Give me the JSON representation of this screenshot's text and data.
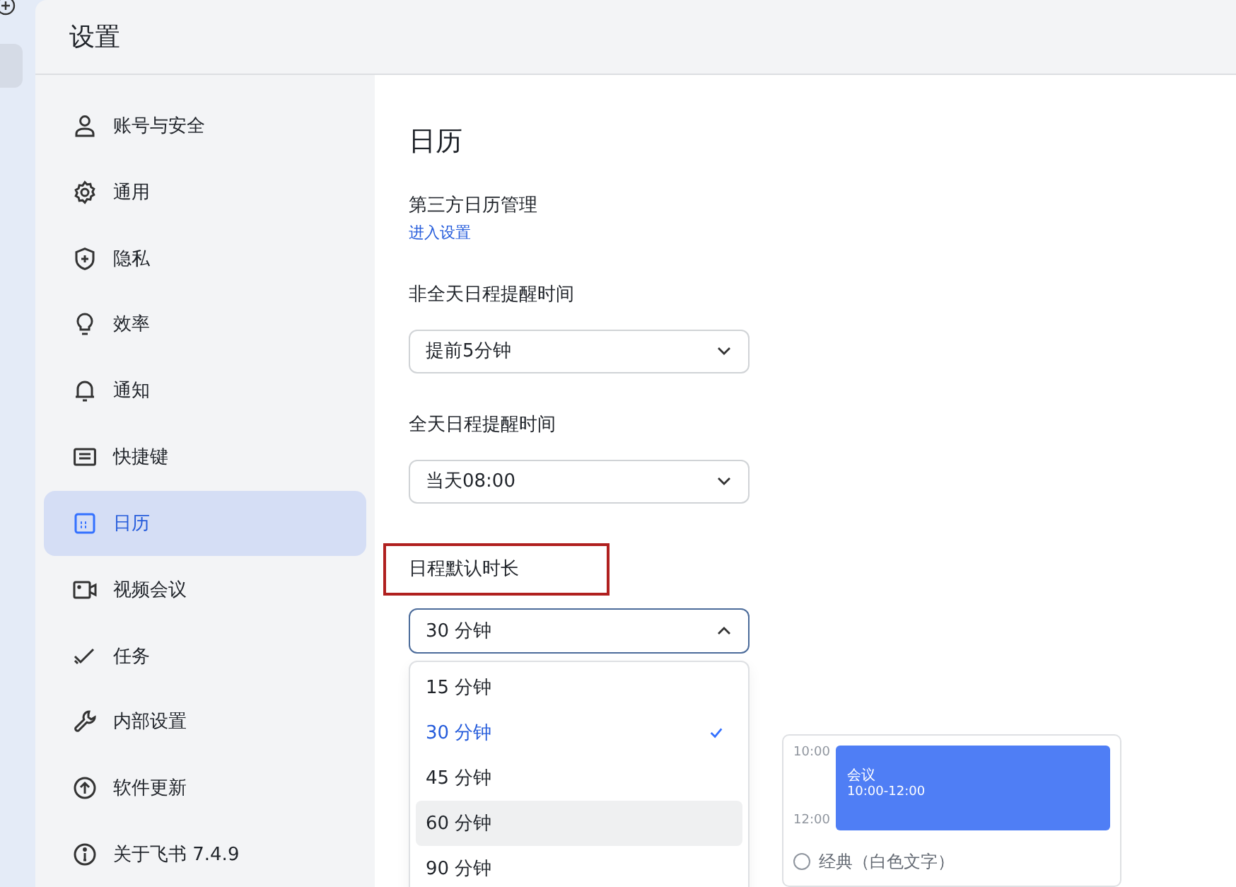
{
  "window": {
    "title": "设置"
  },
  "sidebar": {
    "items": [
      {
        "label": "账号与安全",
        "kind": "person",
        "selected": false
      },
      {
        "label": "通用",
        "kind": "gear",
        "selected": false
      },
      {
        "label": "隐私",
        "kind": "shield",
        "selected": false
      },
      {
        "label": "效率",
        "kind": "bulb",
        "selected": false
      },
      {
        "label": "通知",
        "kind": "bell",
        "selected": false
      },
      {
        "label": "快捷键",
        "kind": "keyboard",
        "selected": false
      },
      {
        "label": "日历",
        "kind": "calendar",
        "selected": true
      },
      {
        "label": "视频会议",
        "kind": "camera",
        "selected": false
      },
      {
        "label": "任务",
        "kind": "check",
        "selected": false
      },
      {
        "label": "内部设置",
        "kind": "wrench",
        "selected": false
      },
      {
        "label": "软件更新",
        "kind": "upload",
        "selected": false
      },
      {
        "label": "关于飞书 7.4.9",
        "kind": "info",
        "selected": false
      }
    ]
  },
  "content": {
    "heading": "日历",
    "third_party": {
      "label": "第三方日历管理",
      "link": "进入设置"
    },
    "timed_reminder": {
      "label": "非全天日程提醒时间",
      "value": "提前5分钟"
    },
    "allday_reminder": {
      "label": "全天日程提醒时间",
      "value": "当天08:00"
    },
    "default_duration": {
      "label": "日程默认时长",
      "value": "30 分钟",
      "expanded": true,
      "options": [
        {
          "label": "15 分钟",
          "selected": false,
          "highlighted": false
        },
        {
          "label": "30 分钟",
          "selected": true,
          "highlighted": false
        },
        {
          "label": "45 分钟",
          "selected": false,
          "highlighted": false
        },
        {
          "label": "60 分钟",
          "selected": false,
          "highlighted": true
        },
        {
          "label": "90 分钟",
          "selected": false,
          "highlighted": false
        }
      ]
    },
    "preview": {
      "times": [
        "10:00",
        "12:00"
      ],
      "event_title": "会议",
      "event_time": "10:00-12:00",
      "option": {
        "label": "经典（白色文字）",
        "selected": false
      }
    }
  }
}
